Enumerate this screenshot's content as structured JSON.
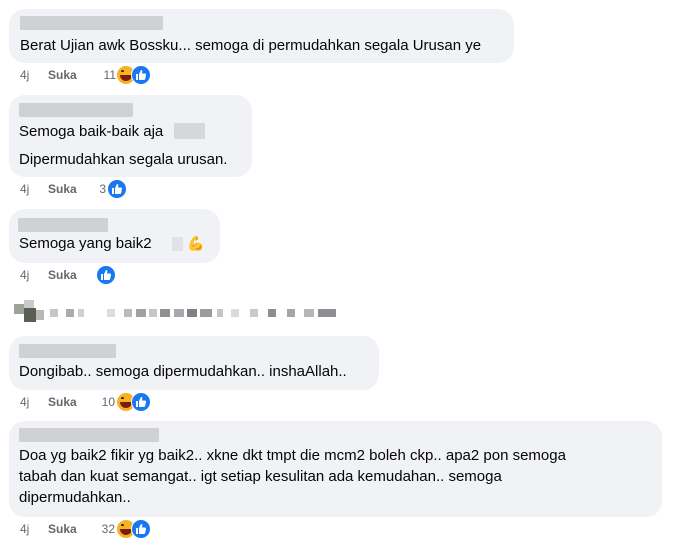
{
  "comments": [
    {
      "text_lines": [
        "Berat Ujian awk Bossku... semoga di permudahkan segala Urusan ye"
      ],
      "time": "4j",
      "like_label": "Suka",
      "count": "11",
      "reactions": [
        "haha-icon",
        "like-icon"
      ]
    },
    {
      "text_lines": [
        "Semoga baik-baik aja",
        "Dipermudahkan segala urusan."
      ],
      "time": "4j",
      "like_label": "Suka",
      "count": "3",
      "reactions": [
        "like-icon"
      ]
    },
    {
      "text_lines": [
        "Semoga yang baik2"
      ],
      "time": "4j",
      "like_label": "Suka",
      "count": "",
      "reactions": [
        "like-icon"
      ],
      "emoji": "💪"
    },
    {
      "text_lines": [
        "Dongibab.. semoga dipermudahkan.. inshaAllah.."
      ],
      "time": "4j",
      "like_label": "Suka",
      "count": "10",
      "reactions": [
        "haha-icon",
        "like-icon"
      ]
    },
    {
      "text_lines": [
        "Doa yg baik2 fikir yg baik2.. xkne dkt tmpt die mcm2 boleh ckp.. apa2 pon semoga",
        "tabah dan kuat semangat.. igt setiap kesulitan ada kemudahan.. semoga",
        "dipermudahkan.."
      ],
      "time": "4j",
      "like_label": "Suka",
      "count": "32",
      "reactions": [
        "haha-icon",
        "like-icon"
      ]
    }
  ],
  "colors": {
    "bubble": "#f0f2f5",
    "text": "#050505",
    "meta": "#65676b",
    "like_blue": "#1877f2",
    "haha_yellow": "#f7b125"
  }
}
